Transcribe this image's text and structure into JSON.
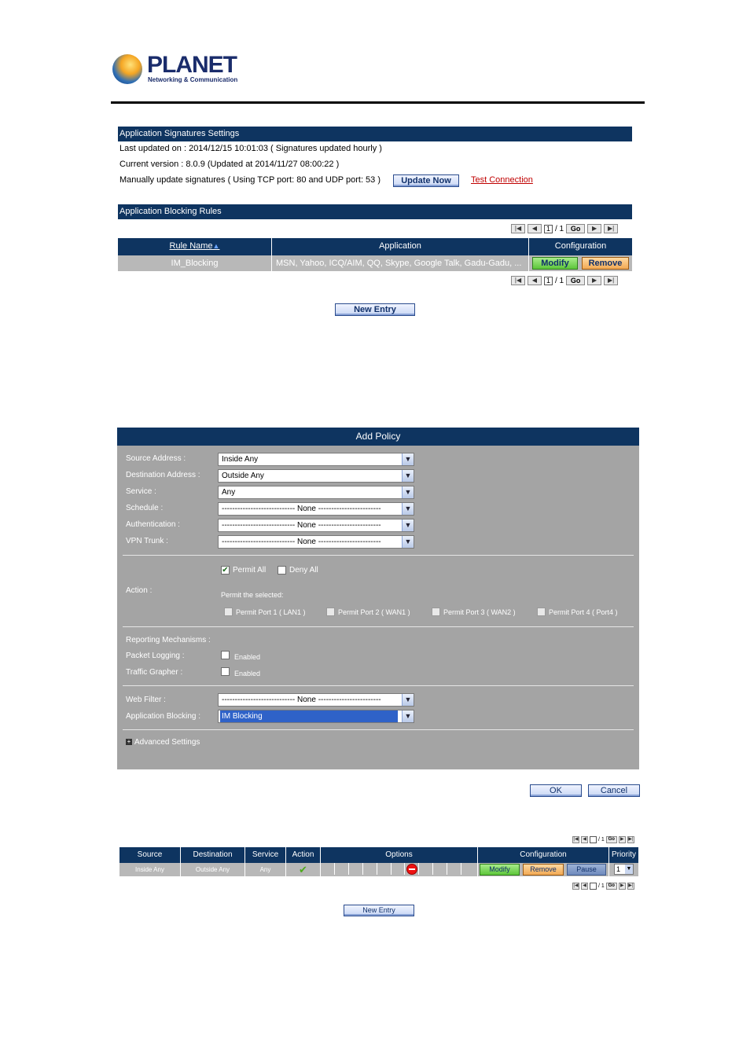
{
  "brand": {
    "name": "PLANET",
    "tagline": "Networking & Communication"
  },
  "signatures": {
    "header": "Application Signatures Settings",
    "last_updated": "Last updated on : 2014/12/15 10:01:03  ( Signatures updated hourly )",
    "current_version": "Current version : 8.0.9 (Updated at 2014/11/27 08:00:22 )",
    "manual_update": "Manually update signatures ( Using TCP port: 80 and UDP port: 53 )",
    "update_now_label": "Update Now",
    "test_connection_label": "Test Connection"
  },
  "blocking_rules": {
    "header": "Application Blocking Rules",
    "pager": {
      "page": "1",
      "total": "/ 1",
      "go": "Go"
    },
    "columns": [
      "Rule Name",
      "Application",
      "Configuration"
    ],
    "sort_arrow": "▲",
    "rows": [
      {
        "rule_name": "IM_Blocking",
        "application": "MSN, Yahoo, ICQ/AIM, QQ, Skype, Google Talk, Gadu-Gadu, ...",
        "modify_label": "Modify",
        "remove_label": "Remove"
      }
    ],
    "new_entry_label": "New Entry"
  },
  "add_policy": {
    "title": "Add Policy",
    "fields": [
      {
        "label": "Source Address :",
        "value": "Inside Any"
      },
      {
        "label": "Destination Address :",
        "value": "Outside Any"
      },
      {
        "label": "Service :",
        "value": "Any"
      },
      {
        "label": "Schedule :",
        "value": "---------------------------- None ------------------------"
      },
      {
        "label": "Authentication :",
        "value": "---------------------------- None ------------------------"
      },
      {
        "label": "VPN Trunk :",
        "value": "---------------------------- None ------------------------"
      }
    ],
    "action": {
      "label": "Action :",
      "permit_all": "Permit All",
      "deny_all": "Deny All",
      "permit_selected": "Permit the selected:",
      "ports": [
        "Permit Port  1  ( LAN1 )",
        "Permit Port  2  ( WAN1 )",
        "Permit Port  3  ( WAN2 )",
        "Permit Port  4  ( Port4 )"
      ]
    },
    "reporting": {
      "label": "Reporting Mechanisms :",
      "packet_logging": "Packet Logging :",
      "traffic_grapher": "Traffic Grapher :",
      "enabled": "Enabled"
    },
    "web_filter": {
      "label": "Web Filter :",
      "value": "---------------------------- None ------------------------"
    },
    "app_blocking": {
      "label": "Application Blocking :",
      "value": "IM Blocking"
    },
    "advanced": "Advanced Settings",
    "ok_label": "OK",
    "cancel_label": "Cancel"
  },
  "policy_table": {
    "columns": [
      "Source",
      "Destination",
      "Service",
      "Action",
      "Options",
      "Configuration",
      "Priority"
    ],
    "pager": {
      "page": "",
      "total": "/ 1",
      "go": "Go"
    },
    "rows": [
      {
        "source": "Inside Any",
        "destination": "Outside Any",
        "service": "Any",
        "modify_label": "Modify",
        "remove_label": "Remove",
        "pause_label": "Pause",
        "priority": "1"
      }
    ],
    "new_entry_label": "New Entry"
  },
  "colors": {
    "header_navy": "#0e3460",
    "panel_gray": "#a4a4a4",
    "row_gray": "#b8b8b8",
    "link_red": "#c00000"
  },
  "icons": {
    "check": "checkmark-icon",
    "block": "no-entry-icon"
  }
}
